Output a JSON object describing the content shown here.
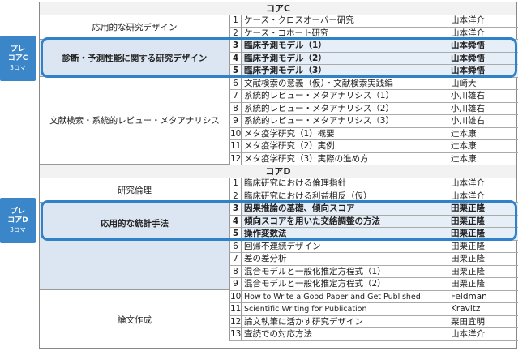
{
  "core_c": {
    "heading": "コアC",
    "side_tag": {
      "line1": "プレ",
      "line2": "コアC",
      "line3": "3コマ"
    },
    "categories": [
      {
        "label": "応用的な研究デザイン"
      },
      {
        "label": "診断・予測性能に関する研究デザイン"
      },
      {
        "label": "文献検索・系統的レビュー・メタアナリシス"
      }
    ],
    "rows": [
      {
        "num": "1",
        "title": "ケース・クロスオーバー研究",
        "inst": "山本洋介"
      },
      {
        "num": "2",
        "title": "ケース・コホート研究",
        "inst": "山本洋介"
      },
      {
        "num": "3",
        "title": "臨床予測モデル（1）",
        "inst": "山本舜悟"
      },
      {
        "num": "4",
        "title": "臨床予測モデル（2）",
        "inst": "山本舜悟"
      },
      {
        "num": "5",
        "title": "臨床予測モデル（3）",
        "inst": "山本舜悟"
      },
      {
        "num": "6",
        "title": "文献検索の意義（仮）・文献検索実践編",
        "inst": "山崎大"
      },
      {
        "num": "7",
        "title": "系統的レビュー・メタアナリシス（1）",
        "inst": "小川雄右"
      },
      {
        "num": "8",
        "title": "系統的レビュー・メタアナリシス（2）",
        "inst": "小川雄右"
      },
      {
        "num": "9",
        "title": "系統的レビュー・メタアナリシス（3）",
        "inst": "小川雄右"
      },
      {
        "num": "10",
        "title": "メタ疫学研究（1）概要",
        "inst": "辻本康"
      },
      {
        "num": "11",
        "title": "メタ疫学研究（2）実例",
        "inst": "辻本康"
      },
      {
        "num": "12",
        "title": "メタ疫学研究（3）実際の進め方",
        "inst": "辻本康"
      }
    ]
  },
  "core_d": {
    "heading": "コアD",
    "side_tag": {
      "line1": "プレ",
      "line2": "コアD",
      "line3": "3コマ"
    },
    "categories": [
      {
        "label": "研究倫理"
      },
      {
        "label": "応用的な統計手法"
      },
      {
        "label": "論文作成"
      }
    ],
    "rows": [
      {
        "num": "1",
        "title": "臨床研究における倫理指針",
        "inst": "山本洋介"
      },
      {
        "num": "2",
        "title": "臨床研究における利益相反（仮）",
        "inst": "山本洋介"
      },
      {
        "num": "3",
        "title": "因果推論の基礎、傾向スコア",
        "inst": "田栗正隆"
      },
      {
        "num": "4",
        "title": "傾向スコアを用いた交絡調整の方法",
        "inst": "田栗正隆"
      },
      {
        "num": "5",
        "title": "操作変数法",
        "inst": "田栗正隆"
      },
      {
        "num": "6",
        "title": "回帰不連続デザイン",
        "inst": "田栗正隆"
      },
      {
        "num": "7",
        "title": "差の差分析",
        "inst": "田栗正隆"
      },
      {
        "num": "8",
        "title": "混合モデルと一般化推定方程式（1）",
        "inst": "田栗正隆"
      },
      {
        "num": "9",
        "title": "混合モデルと一般化推定方程式（2）",
        "inst": "田栗正隆"
      },
      {
        "num": "10",
        "title": "How to Write a Good Paper and Get Published",
        "inst": "Feldman"
      },
      {
        "num": "11",
        "title": "Scientific Writing for Publication",
        "inst": "Kravitz"
      },
      {
        "num": "12",
        "title": "論文執筆に活かす研究デザイン",
        "inst": "栗田宜明"
      },
      {
        "num": "13",
        "title": "査読での対応方法",
        "inst": "山本洋介"
      }
    ]
  },
  "colors": {
    "highlight_border": "#2f82c8",
    "side_tag_bg": "#3a86c8",
    "stat_cat_bg": "#dce6f2"
  }
}
